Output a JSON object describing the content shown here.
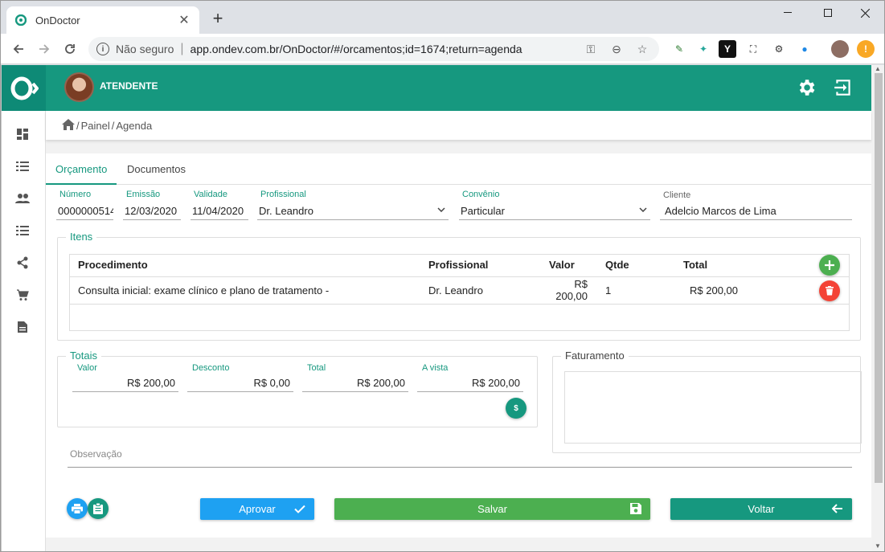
{
  "browser": {
    "tab_title": "OnDoctor",
    "security_label": "Não seguro",
    "url": "app.ondev.com.br/OnDoctor/#/orcamentos;id=1674;return=agenda"
  },
  "header": {
    "role": "ATENDENTE"
  },
  "breadcrumb": {
    "items": [
      "Painel",
      "Agenda"
    ]
  },
  "tabs": [
    {
      "label": "Orçamento",
      "active": true
    },
    {
      "label": "Documentos",
      "active": false
    }
  ],
  "form": {
    "numero": {
      "label": "Número",
      "value": "0000000514"
    },
    "emissao": {
      "label": "Emissão",
      "value": "12/03/2020"
    },
    "validade": {
      "label": "Validade",
      "value": "11/04/2020"
    },
    "profissional": {
      "label": "Profissional",
      "value": "Dr. Leandro"
    },
    "convenio": {
      "label": "Convênio",
      "value": "Particular"
    },
    "cliente": {
      "label": "Cliente",
      "value": "Adelcio Marcos de Lima"
    }
  },
  "itens": {
    "title": "Itens",
    "columns": [
      "Procedimento",
      "Profissional",
      "Valor",
      "Qtde",
      "Total"
    ],
    "rows": [
      {
        "procedimento": "Consulta inicial: exame clínico e plano de tratamento -",
        "profissional": "Dr. Leandro",
        "valor": "R$ 200,00",
        "qtde": "1",
        "total": "R$ 200,00"
      }
    ]
  },
  "totais": {
    "title": "Totais",
    "valor": {
      "label": "Valor",
      "value": "R$ 200,00"
    },
    "desconto": {
      "label": "Desconto",
      "value": "R$ 0,00"
    },
    "total": {
      "label": "Total",
      "value": "R$ 200,00"
    },
    "a_vista": {
      "label": "A vista",
      "value": "R$ 200,00"
    },
    "payment_icon": "$"
  },
  "faturamento": {
    "title": "Faturamento"
  },
  "observacao": {
    "label": "Observação"
  },
  "actions": {
    "aprovar": "Aprovar",
    "salvar": "Salvar",
    "voltar": "Voltar"
  },
  "colors": {
    "primary": "#16987f",
    "approve": "#1ea1f2",
    "save": "#4caf50",
    "delete": "#f44336"
  }
}
